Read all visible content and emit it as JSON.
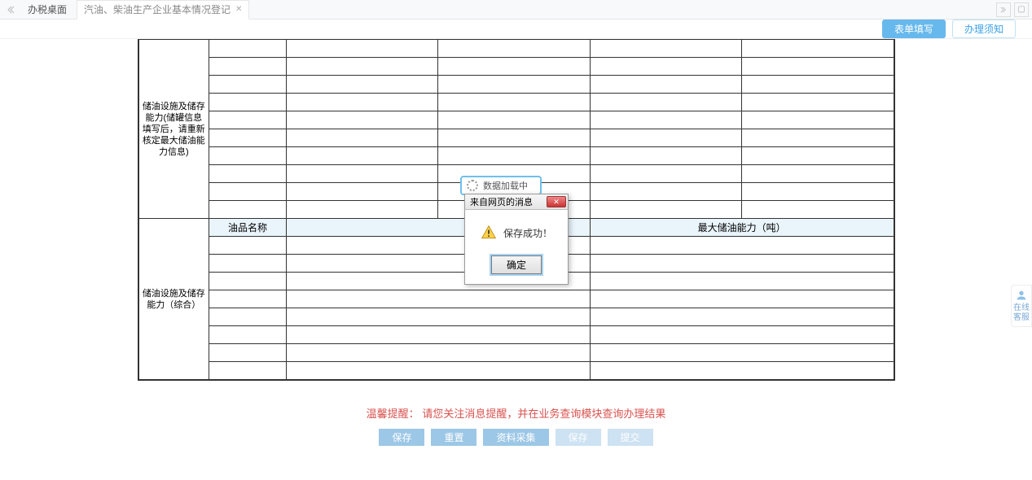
{
  "tabs": {
    "home": "办税桌面",
    "active": "汽油、柴油生产企业基本情况登记"
  },
  "subheader": {
    "fill": "表单填写",
    "notice": "办理须知"
  },
  "table": {
    "section1_header": "储油设施及储存能力(储罐信息填写后，请重新核定最大储油能力信息)",
    "section2_header": "储油设施及储存能力（综合）",
    "col_name": "油品名称",
    "col_max": "最大储油能力（吨）"
  },
  "loading": "数据加载中",
  "modal": {
    "title": "来自网页的消息",
    "message": "保存成功！",
    "ok": "确定"
  },
  "footer": {
    "tip_label": "温馨提醒：",
    "tip_text": "请您关注消息提醒，并在业务查询模块查询办理结果",
    "btn_save": "保存",
    "btn_reset": "重置",
    "btn_preview": "资料采集",
    "btn_4": "保存",
    "btn_5": "提交"
  },
  "side": {
    "label": "在线客服"
  }
}
